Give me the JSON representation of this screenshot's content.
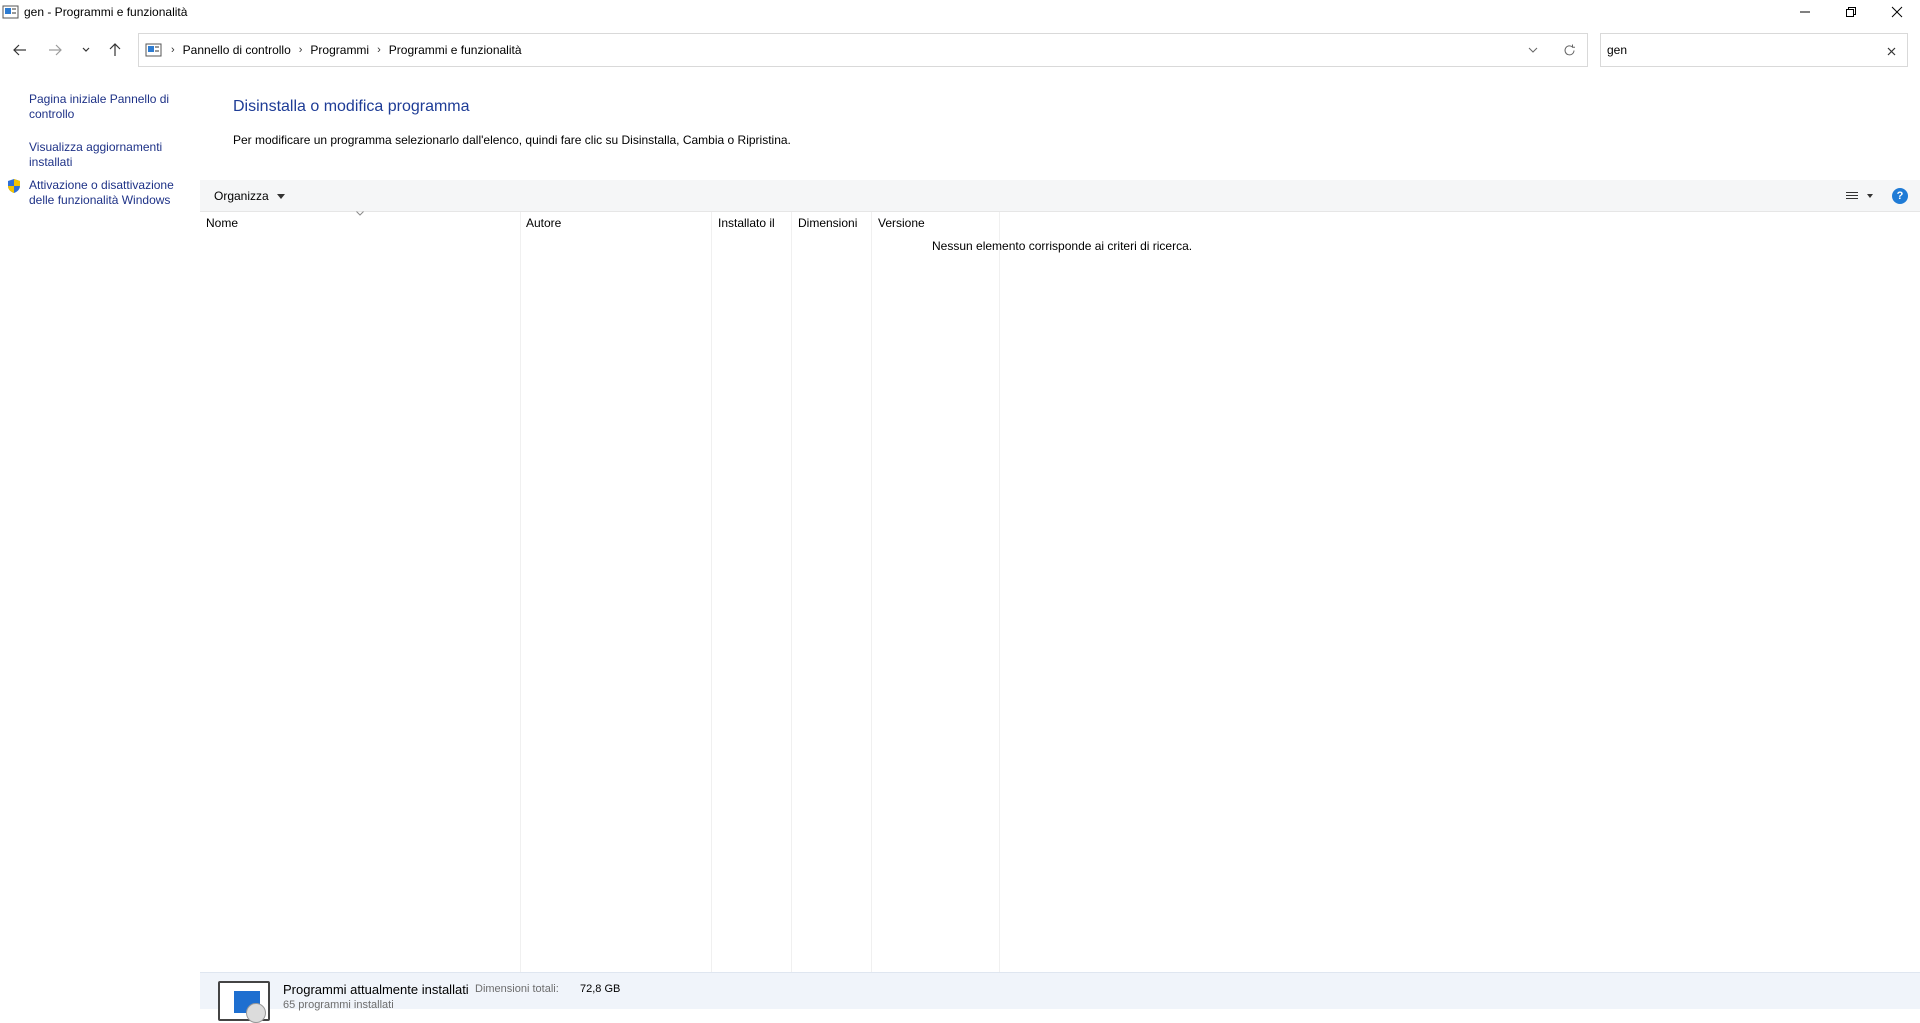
{
  "window": {
    "title": "gen - Programmi e funzionalità"
  },
  "address": {
    "crumbs": [
      "Pannello di controllo",
      "Programmi",
      "Programmi e funzionalità"
    ]
  },
  "search": {
    "value": "gen"
  },
  "sidebar": {
    "items": [
      {
        "label": "Pagina iniziale Pannello di controllo"
      },
      {
        "label": "Visualizza aggiornamenti installati"
      },
      {
        "label": "Attivazione o disattivazione delle funzionalità Windows"
      }
    ]
  },
  "main": {
    "title": "Disinstalla o modifica programma",
    "description": "Per modificare un programma selezionarlo dall'elenco, quindi fare clic su Disinstalla, Cambia o Ripristina."
  },
  "toolbar": {
    "organize_label": "Organizza"
  },
  "columns": [
    "Nome",
    "Autore",
    "Installato il",
    "Dimensioni",
    "Versione"
  ],
  "list": {
    "empty_message": "Nessun elemento corrisponde ai criteri di ricerca."
  },
  "details": {
    "title": "Programmi attualmente installati",
    "size_label": "Dimensioni totali:",
    "size_value": "72,8 GB",
    "count": "65 programmi installati"
  },
  "colors": {
    "link": "#1e3287",
    "heading": "#1e3c96",
    "help": "#1f7bd6"
  },
  "icons": [
    "control-panel-icon",
    "back-arrow-icon",
    "forward-arrow-icon",
    "recent-chevron-icon",
    "up-arrow-icon",
    "dropdown-chevron-icon",
    "refresh-icon",
    "close-icon",
    "shield-icon",
    "view-options-icon",
    "help-icon",
    "programs-icon"
  ]
}
